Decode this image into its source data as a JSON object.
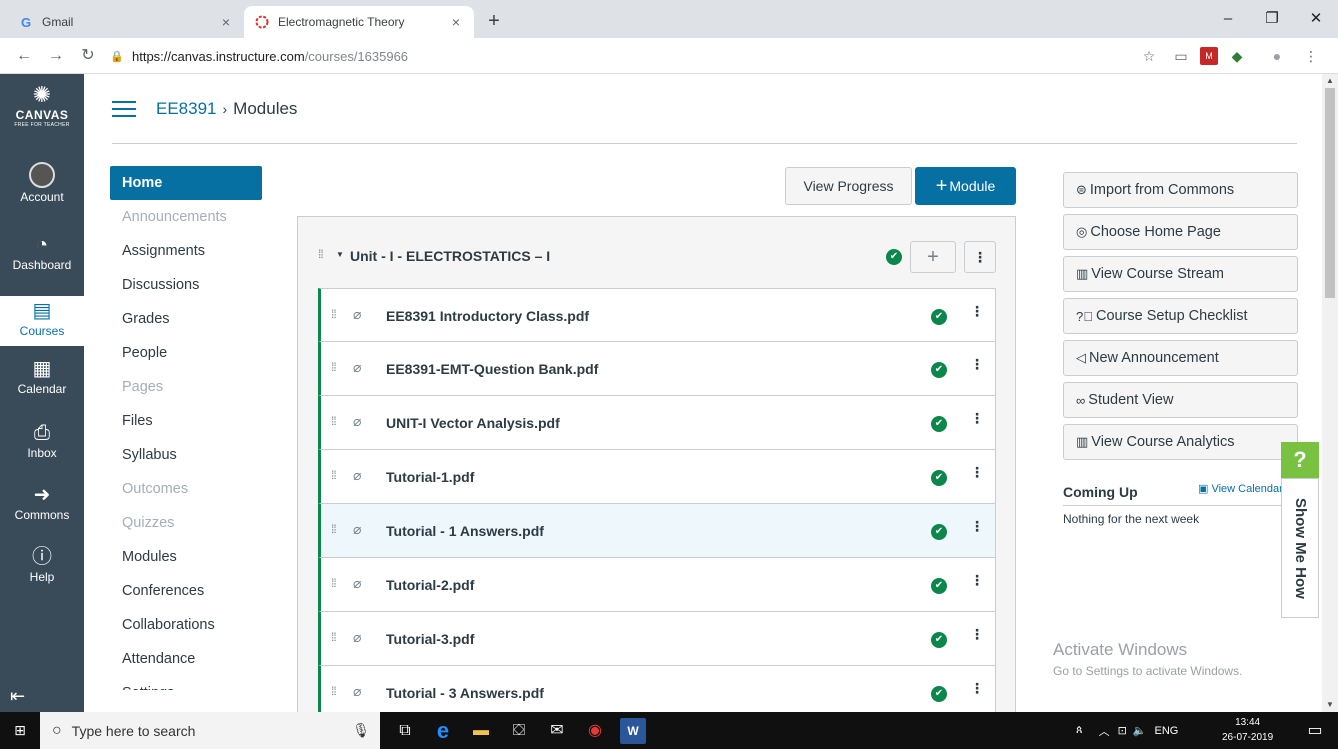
{
  "browser": {
    "tabs": [
      {
        "title": "Gmail",
        "favicon": "G"
      },
      {
        "title": "Electromagnetic Theory",
        "favicon": "canvas-icon"
      }
    ],
    "url_host": "https://canvas.instructure.com",
    "url_path": "/courses/1635966"
  },
  "global_nav": {
    "logo_word": "CANVAS",
    "logo_sub": "FREE FOR TEACHER",
    "items": [
      {
        "label": "Account"
      },
      {
        "label": "Dashboard"
      },
      {
        "label": "Courses"
      },
      {
        "label": "Calendar"
      },
      {
        "label": "Inbox"
      },
      {
        "label": "Commons"
      },
      {
        "label": "Help"
      }
    ]
  },
  "breadcrumb": {
    "course": "EE8391",
    "separator": "›",
    "current": "Modules"
  },
  "course_nav": [
    "Home",
    "Announcements",
    "Assignments",
    "Discussions",
    "Grades",
    "People",
    "Pages",
    "Files",
    "Syllabus",
    "Outcomes",
    "Quizzes",
    "Modules",
    "Conferences",
    "Collaborations",
    "Attendance",
    "Settings"
  ],
  "toolbar": {
    "view_progress": "View Progress",
    "add_module_plus": "+",
    "add_module": "Module"
  },
  "module": {
    "title": "Unit - I - ELECTROSTATICS – I",
    "items": [
      "EE8391 Introductory Class.pdf",
      "EE8391-EMT-Question Bank.pdf",
      "UNIT-I Vector Analysis.pdf",
      "Tutorial-1.pdf",
      "Tutorial - 1 Answers.pdf",
      "Tutorial-2.pdf",
      "Tutorial-3.pdf",
      "Tutorial - 3 Answers.pdf"
    ]
  },
  "sidebar": {
    "buttons": [
      "Import from Commons",
      "Choose Home Page",
      "View Course Stream",
      "Course Setup Checklist",
      "New Announcement",
      "Student View",
      "View Course Analytics"
    ],
    "coming_up": "Coming Up",
    "view_calendar": "View Calendar",
    "coming_up_empty": "Nothing for the next week"
  },
  "show_me_how": {
    "q": "?",
    "label": "Show Me How"
  },
  "activate_windows": {
    "title": "Activate Windows",
    "subtitle": "Go to Settings to activate Windows."
  },
  "taskbar": {
    "search_placeholder": "Type here to search",
    "lang": "ENG",
    "time": "13:44",
    "date": "26-07-2019"
  },
  "colors": {
    "canvas_nav": "#394b58",
    "brand_blue": "#0770a3",
    "published_green": "#0b874b"
  }
}
